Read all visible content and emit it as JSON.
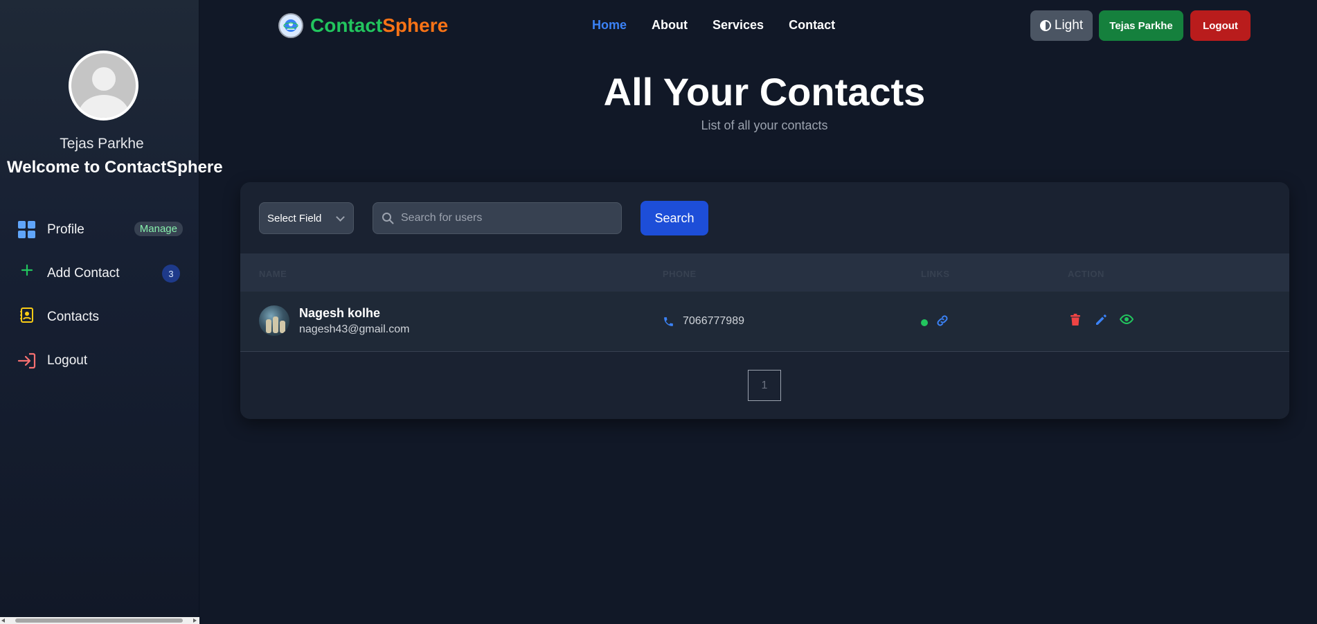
{
  "sidebar": {
    "user_name": "Tejas Parkhe",
    "welcome": "Welcome to ContactSphere",
    "items": [
      {
        "label": "Profile",
        "badge": "Manage",
        "icon": "grid-icon"
      },
      {
        "label": "Add Contact",
        "badge": "3",
        "icon": "plus-icon"
      },
      {
        "label": "Contacts",
        "icon": "contact-book-icon"
      },
      {
        "label": "Logout",
        "icon": "logout-icon"
      }
    ]
  },
  "navbar": {
    "brand_part1": "Contact",
    "brand_part2": "Sphere",
    "links": [
      "Home",
      "About",
      "Services",
      "Contact"
    ],
    "active_link": "Home",
    "theme_button": "Light",
    "user_button": "Tejas Parkhe",
    "logout_button": "Logout"
  },
  "page": {
    "title": "All Your Contacts",
    "subtitle": "List of all your contacts"
  },
  "search": {
    "select_label": "Select Field",
    "placeholder": "Search for users",
    "button": "Search"
  },
  "table": {
    "headers": [
      "NAME",
      "PHONE",
      "LINKS",
      "ACTION"
    ],
    "rows": [
      {
        "name": "Nagesh kolhe",
        "email": "nagesh43@gmail.com",
        "phone": "7066777989"
      }
    ]
  },
  "pagination": {
    "current": "1"
  },
  "colors": {
    "accent": "#3b82f6",
    "brand_green": "#22c55e",
    "brand_orange": "#f97316",
    "delete": "#ef4444",
    "view": "#22c55e"
  }
}
